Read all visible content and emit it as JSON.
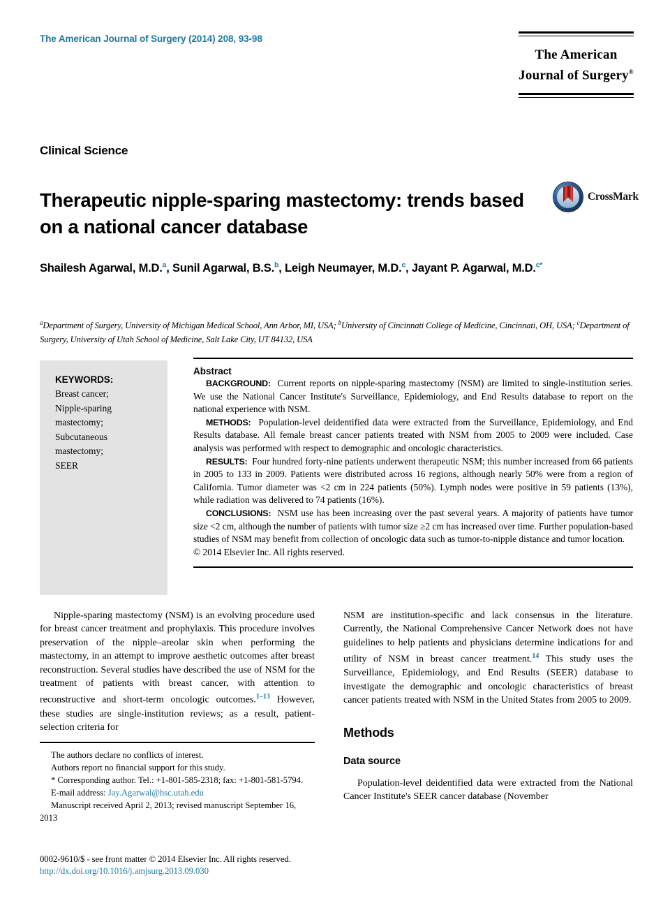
{
  "header": {
    "journal_reference": "The American Journal of Surgery (2014) 208, 93-98",
    "logo_line_1": "The American",
    "logo_line_2": "Journal of Surgery",
    "logo_trademark": "®"
  },
  "article": {
    "kicker": "Clinical Science",
    "title": "Therapeutic nipple-sparing mastectomy: trends based on a national cancer database",
    "crossmark_label": "CrossMark"
  },
  "authors": {
    "list": [
      {
        "name": "Shailesh Agarwal, M.D.",
        "marker": "a",
        "sep": ", "
      },
      {
        "name": "Sunil Agarwal, B.S.",
        "marker": "b",
        "sep": ", "
      },
      {
        "name": "Leigh Neumayer, M.D.",
        "marker": "c",
        "sep": ", "
      },
      {
        "name": "Jayant P. Agarwal, M.D.",
        "marker": "c",
        "sep": ""
      }
    ],
    "corresponding_star": "*"
  },
  "affiliations": {
    "a_marker": "a",
    "a_text": "Department of Surgery, University of Michigan Medical School, Ann Arbor, MI, USA; ",
    "b_marker": "b",
    "b_text": "University of Cincinnati College of Medicine, Cincinnati, OH, USA; ",
    "c_marker": "c",
    "c_text": "Department of Surgery, University of Utah School of Medicine, Salt Lake City, UT 84132, USA"
  },
  "keywords": {
    "title": "KEYWORDS:",
    "items_text": "Breast cancer; Nipple-sparing mastectomy; Subcutaneous mastectomy; SEER",
    "items": [
      "Breast cancer;",
      "Nipple-sparing",
      "mastectomy;",
      "Subcutaneous",
      "mastectomy;",
      "SEER"
    ]
  },
  "abstract": {
    "heading": "Abstract",
    "sections": [
      {
        "label": "BACKGROUND:",
        "text": "Current reports on nipple-sparing mastectomy (NSM) are limited to single-institution series. We use the National Cancer Institute's Surveillance, Epidemiology, and End Results database to report on the national experience with NSM."
      },
      {
        "label": "METHODS:",
        "text": "Population-level deidentified data were extracted from the Surveillance, Epidemiology, and End Results database. All female breast cancer patients treated with NSM from 2005 to 2009 were included. Case analysis was performed with respect to demographic and oncologic characteristics."
      },
      {
        "label": "RESULTS:",
        "text": "Four hundred forty-nine patients underwent therapeutic NSM; this number increased from 66 patients in 2005 to 133 in 2009. Patients were distributed across 16 regions, although nearly 50% were from a region of California. Tumor diameter was <2 cm in 224 patients (50%). Lymph nodes were positive in 59 patients (13%), while radiation was delivered to 74 patients (16%)."
      },
      {
        "label": "CONCLUSIONS:",
        "text": "NSM use has been increasing over the past several years. A majority of patients have tumor size <2 cm, although the number of patients with tumor size ≥2 cm has increased over time. Further population-based studies of NSM may benefit from collection of oncologic data such as tumor-to-nipple distance and tumor location."
      }
    ],
    "copyright": "© 2014 Elsevier Inc. All rights reserved."
  },
  "body": {
    "left_para_1_a": "Nipple-sparing mastectomy (NSM) is an evolving procedure used for breast cancer treatment and prophylaxis. This procedure involves preservation of the nipple–areolar skin when performing the mastectomy, in an attempt to improve aesthetic outcomes after breast reconstruction. Several studies have described the use of NSM for the treatment of patients with breast cancer, with attention to reconstructive and short-term oncologic outcomes.",
    "left_para_1_ref": "1–13",
    "left_para_1_b": " However, these studies are single-institution reviews; as a result, patient-selection criteria for",
    "right_para_1_a": "NSM are institution-specific and lack consensus in the literature. Currently, the National Comprehensive Cancer Network does not have guidelines to help patients and physicians determine indications for and utility of NSM in breast cancer treatment.",
    "right_para_1_ref": "14",
    "right_para_1_b": " This study uses the Surveillance, Epidemiology, and End Results (SEER) database to investigate the demographic and oncologic characteristics of breast cancer patients treated with NSM in the United States from 2005 to 2009.",
    "methods_heading": "Methods",
    "data_source_heading": "Data source",
    "data_source_para": "Population-level deidentified data were extracted from the National Cancer Institute's SEER cancer database (November"
  },
  "footnotes": {
    "conflicts": "The authors declare no conflicts of interest.",
    "funding": "Authors report no financial support for this study.",
    "corresponding": "* Corresponding author. Tel.: +1-801-585-2318; fax: +1-801-581-5794.",
    "email_label": "E-mail address: ",
    "email": "Jay.Agarwal@hsc.utah.edu",
    "manuscript": "Manuscript received April 2, 2013; revised manuscript September 16, 2013"
  },
  "bottom": {
    "issn": "0002-9610/$ - see front matter © 2014 Elsevier Inc. All rights reserved.",
    "doi": "http://dx.doi.org/10.1016/j.amjsurg.2013.09.030"
  },
  "colors": {
    "accent_blue": "#1a78a5",
    "keyword_panel": "#e3e3e3"
  }
}
